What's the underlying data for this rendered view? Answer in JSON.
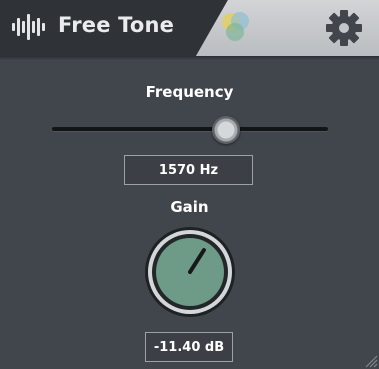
{
  "header": {
    "title": "Free Tone",
    "icons": [
      "bars-logo-icon",
      "color-circles-logo-icon",
      "gear-icon"
    ]
  },
  "frequency": {
    "label": "Frequency",
    "value_text": "1570 Hz",
    "slider_fraction": 0.63
  },
  "gain": {
    "label": "Gain",
    "value_text": "-11.40 dB",
    "knob_fraction": 0.62
  },
  "colors": {
    "header_dark": "#2f3338",
    "header_light": "#c6c9cc",
    "panel": "#41454c",
    "knob_face": "#6e9b87",
    "logo_yellow": "#e3cf64",
    "logo_green": "#7fb79a",
    "logo_blue": "#8fbfd2"
  }
}
